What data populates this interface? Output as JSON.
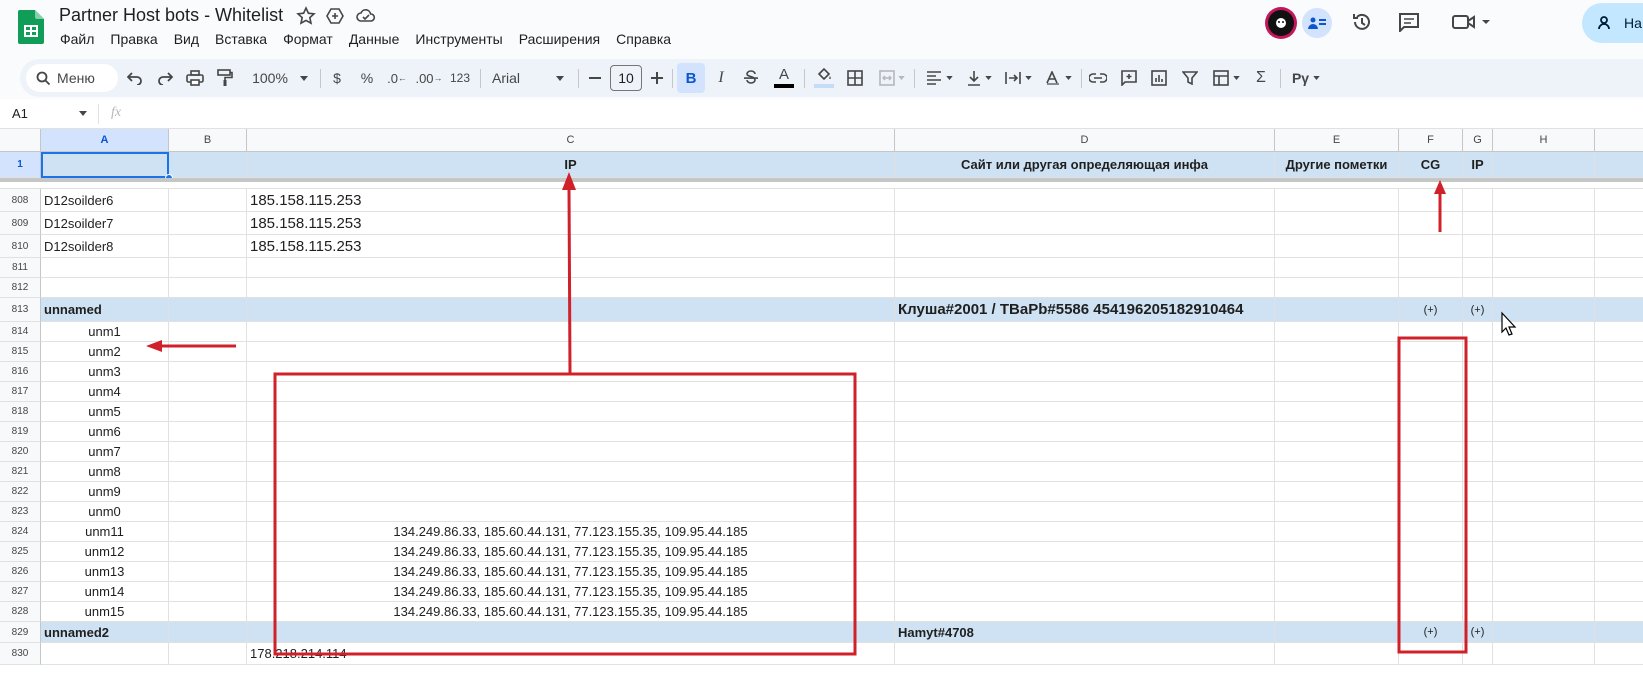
{
  "app": {
    "title": "Partner Host bots - Whitelist",
    "share_label": "На"
  },
  "menu": [
    "Файл",
    "Правка",
    "Вид",
    "Вставка",
    "Формат",
    "Данные",
    "Инструменты",
    "Расширения",
    "Справка"
  ],
  "toolbar": {
    "search_label": "Меню",
    "zoom": "100%",
    "currency": "$",
    "percent": "%",
    "dec_dec": ".0",
    "dec_inc": ".00",
    "number_format": "123",
    "font": "Arial",
    "font_size": "10",
    "bold": "B",
    "italic": "I",
    "text_color": "A"
  },
  "formula": {
    "cell_ref": "A1",
    "fx": "fx",
    "value": ""
  },
  "columns": [
    "A",
    "B",
    "C",
    "D",
    "E",
    "F",
    "G",
    "H"
  ],
  "header_row": {
    "num": "1",
    "A": "",
    "B": "",
    "C": "IP",
    "D": "Сайт или другая определяющая инфа",
    "E": "Другие пометки",
    "F": "CG",
    "G": "IP",
    "H": ""
  },
  "rows": [
    {
      "num": "808",
      "A": "D12soilder6",
      "C": "185.158.115.253"
    },
    {
      "num": "809",
      "A": "D12soilder7",
      "C": "185.158.115.253"
    },
    {
      "num": "810",
      "A": "D12soilder8",
      "C": "185.158.115.253"
    },
    {
      "num": "811"
    },
    {
      "num": "812"
    },
    {
      "num": "813",
      "A": "unnamed",
      "D": "Клуша#2001 / TBaPb#5586 454196205182910464",
      "F": "(+)",
      "G": "(+)"
    },
    {
      "num": "814",
      "A": "unm1"
    },
    {
      "num": "815",
      "A": "unm2"
    },
    {
      "num": "816",
      "A": "unm3"
    },
    {
      "num": "817",
      "A": "unm4"
    },
    {
      "num": "818",
      "A": "unm5"
    },
    {
      "num": "819",
      "A": "unm6"
    },
    {
      "num": "820",
      "A": "unm7"
    },
    {
      "num": "821",
      "A": "unm8"
    },
    {
      "num": "822",
      "A": "unm9"
    },
    {
      "num": "823",
      "A": "unm0"
    },
    {
      "num": "824",
      "A": "unm11",
      "C": "134.249.86.33, 185.60.44.131, 77.123.155.35, 109.95.44.185"
    },
    {
      "num": "825",
      "A": "unm12",
      "C": "134.249.86.33, 185.60.44.131, 77.123.155.35, 109.95.44.185"
    },
    {
      "num": "826",
      "A": "unm13",
      "C": "134.249.86.33, 185.60.44.131, 77.123.155.35, 109.95.44.185"
    },
    {
      "num": "827",
      "A": "unm14",
      "C": "134.249.86.33, 185.60.44.131, 77.123.155.35, 109.95.44.185"
    },
    {
      "num": "828",
      "A": "unm15",
      "C": "134.249.86.33, 185.60.44.131, 77.123.155.35, 109.95.44.185"
    },
    {
      "num": "829",
      "A": "unnamed2",
      "D": "Hamyt#4708",
      "F": "(+)",
      "G": "(+)"
    },
    {
      "num": "830",
      "C": "178.218.214.114"
    }
  ],
  "colors": {
    "accent": "#0b57d0",
    "annotation_red": "#d0202a",
    "row_highlight": "#cfe2f3",
    "share_bg": "#c2e7ff"
  }
}
